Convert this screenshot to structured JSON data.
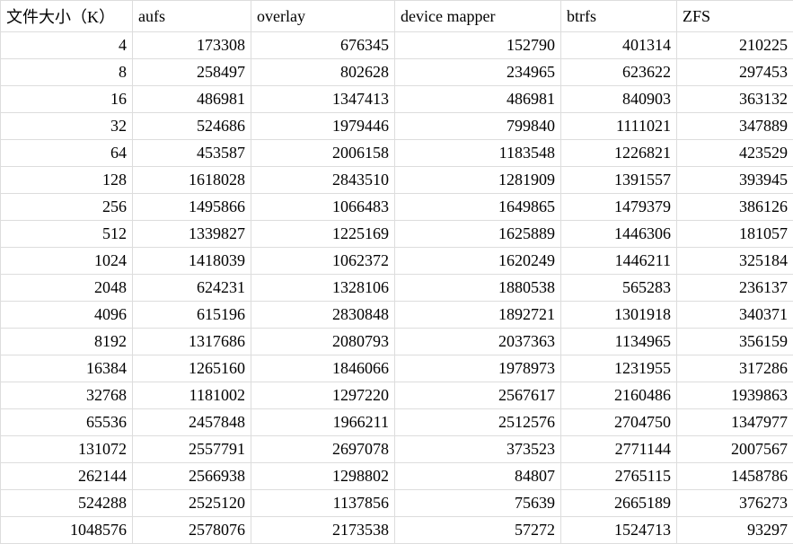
{
  "chart_data": {
    "type": "table",
    "title": "",
    "columns": [
      "文件大小（K）",
      "aufs",
      "overlay",
      "device mapper",
      "btrfs",
      "ZFS"
    ],
    "rows": [
      [
        4,
        173308,
        676345,
        152790,
        401314,
        210225
      ],
      [
        8,
        258497,
        802628,
        234965,
        623622,
        297453
      ],
      [
        16,
        486981,
        1347413,
        486981,
        840903,
        363132
      ],
      [
        32,
        524686,
        1979446,
        799840,
        1111021,
        347889
      ],
      [
        64,
        453587,
        2006158,
        1183548,
        1226821,
        423529
      ],
      [
        128,
        1618028,
        2843510,
        1281909,
        1391557,
        393945
      ],
      [
        256,
        1495866,
        1066483,
        1649865,
        1479379,
        386126
      ],
      [
        512,
        1339827,
        1225169,
        1625889,
        1446306,
        181057
      ],
      [
        1024,
        1418039,
        1062372,
        1620249,
        1446211,
        325184
      ],
      [
        2048,
        624231,
        1328106,
        1880538,
        565283,
        236137
      ],
      [
        4096,
        615196,
        2830848,
        1892721,
        1301918,
        340371
      ],
      [
        8192,
        1317686,
        2080793,
        2037363,
        1134965,
        356159
      ],
      [
        16384,
        1265160,
        1846066,
        1978973,
        1231955,
        317286
      ],
      [
        32768,
        1181002,
        1297220,
        2567617,
        2160486,
        1939863
      ],
      [
        65536,
        2457848,
        1966211,
        2512576,
        2704750,
        1347977
      ],
      [
        131072,
        2557791,
        2697078,
        373523,
        2771144,
        2007567
      ],
      [
        262144,
        2566938,
        1298802,
        84807,
        2765115,
        1458786
      ],
      [
        524288,
        2525120,
        1137856,
        75639,
        2665189,
        376273
      ],
      [
        1048576,
        2578076,
        2173538,
        57272,
        1524713,
        93297
      ]
    ]
  }
}
